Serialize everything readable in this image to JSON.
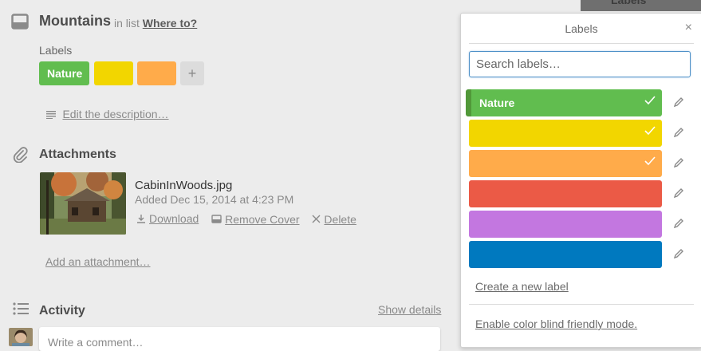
{
  "background": {
    "right_tab_label": "Labels"
  },
  "card": {
    "title": "Mountains",
    "in_list_prefix": "in list",
    "list_name": "Where to?",
    "labels_heading": "Labels",
    "labels": [
      {
        "text": "Nature",
        "color": "#61bd4f"
      },
      {
        "text": "",
        "color": "#f2d600"
      },
      {
        "text": "",
        "color": "#ffab4a"
      }
    ],
    "add_label_glyph": "+",
    "edit_description": "Edit the description…"
  },
  "attachments": {
    "title": "Attachments",
    "file_name": "CabinInWoods.jpg",
    "added": "Added Dec 15, 2014 at 4:23 PM",
    "download": "Download",
    "remove_cover": "Remove Cover",
    "delete": "Delete",
    "add": "Add an attachment…"
  },
  "activity": {
    "title": "Activity",
    "show_details": "Show details",
    "comment_placeholder": "Write a comment…"
  },
  "popover": {
    "title": "Labels",
    "close_glyph": "×",
    "search_placeholder": "Search labels…",
    "labels": [
      {
        "name": "Nature",
        "color": "#61bd4f",
        "checked": true
      },
      {
        "name": "",
        "color": "#f2d600",
        "checked": true
      },
      {
        "name": "",
        "color": "#ffab4a",
        "checked": true
      },
      {
        "name": "",
        "color": "#eb5a46",
        "checked": false
      },
      {
        "name": "",
        "color": "#c377e0",
        "checked": false
      },
      {
        "name": "",
        "color": "#0079bf",
        "checked": false
      }
    ],
    "create_label": "Create a new label",
    "color_blind": "Enable color blind friendly mode."
  },
  "icons": [
    "card-icon",
    "description-icon",
    "paperclip-icon",
    "download-icon",
    "cover-icon",
    "delete-icon",
    "activity-list-icon",
    "close-icon",
    "check-icon",
    "pencil-icon"
  ]
}
